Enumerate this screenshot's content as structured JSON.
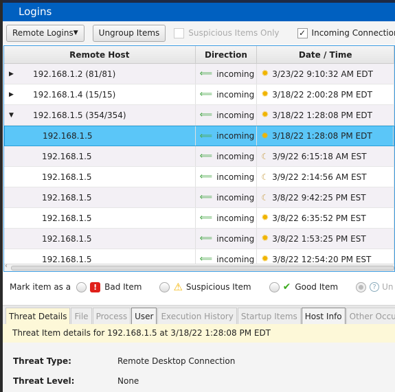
{
  "window": {
    "title": "Logins"
  },
  "toolbar": {
    "view_select": "Remote Logins",
    "ungroup": "Ungroup Items",
    "suspicious_only": "Suspicious Items Only",
    "suspicious_checked": false,
    "incoming": "Incoming Connections",
    "incoming_checked": true
  },
  "table": {
    "columns": [
      "Remote Host",
      "Direction",
      "Date / Time"
    ],
    "rows": [
      {
        "expander": "collapsed",
        "host": "192.168.1.2 (81/81)",
        "direction": "incoming",
        "icon": "sun",
        "datetime": "3/23/22 9:10:32 AM EDT"
      },
      {
        "expander": "collapsed",
        "host": "192.168.1.4 (15/15)",
        "direction": "incoming",
        "icon": "sun",
        "datetime": "3/18/22 2:00:28 PM EDT"
      },
      {
        "expander": "expanded",
        "host": "192.168.1.5 (354/354)",
        "direction": "incoming",
        "icon": "sun",
        "datetime": "3/18/22 1:28:08 PM EDT"
      },
      {
        "host": "192.168.1.5",
        "direction": "incoming",
        "icon": "sun",
        "datetime": "3/18/22 1:28:08 PM EDT",
        "selected": true
      },
      {
        "host": "192.168.1.5",
        "direction": "incoming",
        "icon": "moon",
        "datetime": "3/9/22 6:15:18 AM EST"
      },
      {
        "host": "192.168.1.5",
        "direction": "incoming",
        "icon": "moon",
        "datetime": "3/9/22 2:14:56 AM EST"
      },
      {
        "host": "192.168.1.5",
        "direction": "incoming",
        "icon": "moon",
        "datetime": "3/8/22 9:42:25 PM EST"
      },
      {
        "host": "192.168.1.5",
        "direction": "incoming",
        "icon": "sun",
        "datetime": "3/8/22 6:35:52 PM EST"
      },
      {
        "host": "192.168.1.5",
        "direction": "incoming",
        "icon": "sun",
        "datetime": "3/8/22 1:53:25 PM EST"
      },
      {
        "host": "192.168.1.5",
        "direction": "incoming",
        "icon": "sun",
        "datetime": "3/8/22 12:54:20 PM EST"
      }
    ]
  },
  "mark": {
    "label": "Mark item as a",
    "bad": "Bad Item",
    "suspicious": "Suspicious Item",
    "good": "Good Item",
    "unknown": "Un"
  },
  "tabs": [
    {
      "label": "Threat Details",
      "state": "active"
    },
    {
      "label": "File",
      "state": "disabled"
    },
    {
      "label": "Process",
      "state": "disabled"
    },
    {
      "label": "User",
      "state": "enabled"
    },
    {
      "label": "Execution History",
      "state": "disabled"
    },
    {
      "label": "Startup Items",
      "state": "disabled"
    },
    {
      "label": "Host Info",
      "state": "enabled"
    },
    {
      "label": "Other Occurrences",
      "state": "disabled"
    }
  ],
  "info": "Threat Item details for 192.168.1.5 at 3/18/22 1:28:08 PM EDT",
  "details": [
    {
      "label": "Threat Type:",
      "value": "Remote Desktop Connection"
    },
    {
      "label": "Threat Level:",
      "value": "None"
    }
  ]
}
